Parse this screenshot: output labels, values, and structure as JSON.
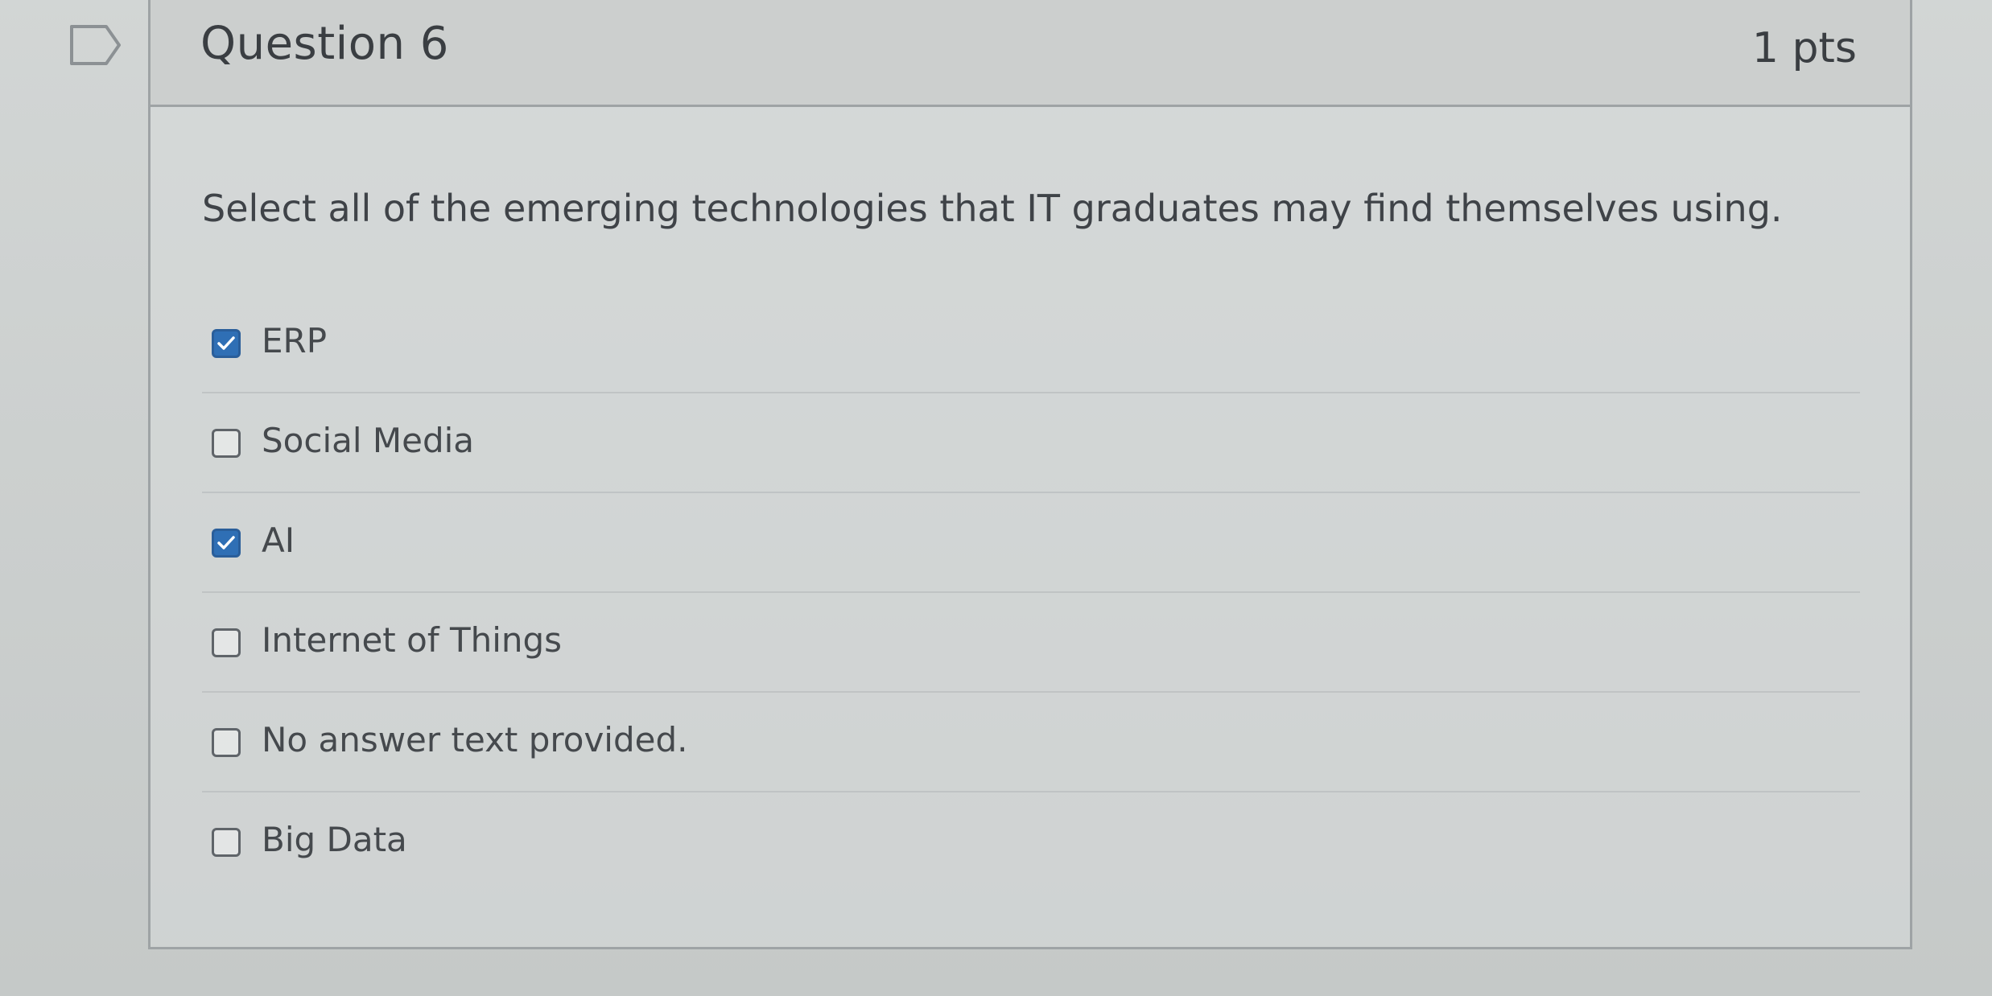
{
  "question": {
    "title": "Question 6",
    "points": "1 pts",
    "text": "Select all of the emerging technologies that IT graduates may find themselves using."
  },
  "answers": [
    {
      "label": "ERP",
      "checked": true
    },
    {
      "label": "Social Media",
      "checked": false
    },
    {
      "label": "AI",
      "checked": true
    },
    {
      "label": "Internet of Things",
      "checked": false
    },
    {
      "label": "No answer text provided.",
      "checked": false
    },
    {
      "label": "Big Data",
      "checked": false
    }
  ],
  "icons": {
    "flag": "flag-icon",
    "check": "checkmark-icon"
  },
  "colors": {
    "checkbox_checked": "#2f6fb5"
  }
}
